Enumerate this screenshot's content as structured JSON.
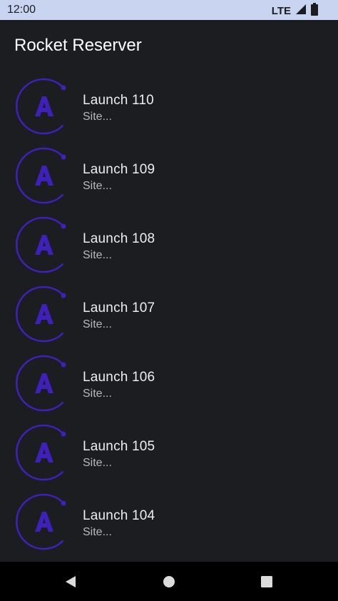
{
  "status_bar": {
    "time": "12:00",
    "network": "LTE"
  },
  "app": {
    "title": "Rocket Reserver"
  },
  "launches": [
    {
      "title": "Launch 110",
      "subtitle": "Site..."
    },
    {
      "title": "Launch 109",
      "subtitle": "Site..."
    },
    {
      "title": "Launch 108",
      "subtitle": "Site..."
    },
    {
      "title": "Launch 107",
      "subtitle": "Site..."
    },
    {
      "title": "Launch 106",
      "subtitle": "Site..."
    },
    {
      "title": "Launch 105",
      "subtitle": "Site..."
    },
    {
      "title": "Launch 104",
      "subtitle": "Site..."
    }
  ],
  "colors": {
    "background": "#1b1d21",
    "status_bar": "#c9d5f0",
    "logo_accent": "#3f20ba"
  },
  "icons": {
    "list_item_logo": "apollo-logo-icon",
    "signal": "signal-icon",
    "battery": "battery-icon",
    "nav_back": "back-triangle-icon",
    "nav_home": "home-circle-icon",
    "nav_recents": "recents-square-icon"
  }
}
